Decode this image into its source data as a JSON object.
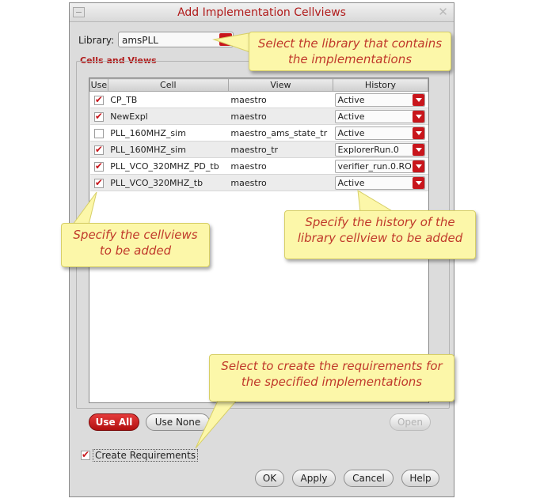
{
  "dialog": {
    "title": "Add Implementation Cellviews",
    "library_label": "Library:",
    "library_value": "amsPLL",
    "section_title": "Cells and Views"
  },
  "table": {
    "headers": [
      "Use",
      "Cell",
      "View",
      "History"
    ],
    "rows": [
      {
        "use": true,
        "cell": "CP_TB",
        "view": "maestro",
        "history": "Active"
      },
      {
        "use": true,
        "cell": "NewExpl",
        "view": "maestro",
        "history": "Active"
      },
      {
        "use": false,
        "cell": "PLL_160MHZ_sim",
        "view": "maestro_ams_state_tr",
        "history": "Active"
      },
      {
        "use": true,
        "cell": "PLL_160MHZ_sim",
        "view": "maestro_tr",
        "history": "ExplorerRun.0"
      },
      {
        "use": true,
        "cell": "PLL_VCO_320MHZ_PD_tb",
        "view": "maestro",
        "history": "verifier_run.0.RO"
      },
      {
        "use": true,
        "cell": "PLL_VCO_320MHZ_tb",
        "view": "maestro",
        "history": "Active"
      }
    ]
  },
  "buttons": {
    "use_all": "Use All",
    "use_none": "Use None",
    "open": "Open",
    "ok": "OK",
    "apply": "Apply",
    "cancel": "Cancel",
    "help": "Help"
  },
  "create_requirements": {
    "label": "Create Requirements",
    "checked": true
  },
  "callouts": {
    "library": "Select the library that contains the implementations",
    "cellviews": "Specify the cellviews to be added",
    "history": "Specify the history of the library cellview to be added",
    "requirements": "Select to create the requirements for the specified implementations"
  },
  "colors": {
    "accent_red": "#c8161c",
    "title_red": "#b01a1a",
    "callout_fill": "#fcf7a9",
    "callout_text": "#c0392b"
  },
  "icons": {
    "dropdown": "chevron-down-icon",
    "checkbox": "checkmark-icon",
    "window_min": "minimize-icon",
    "window_close": "close-icon"
  }
}
